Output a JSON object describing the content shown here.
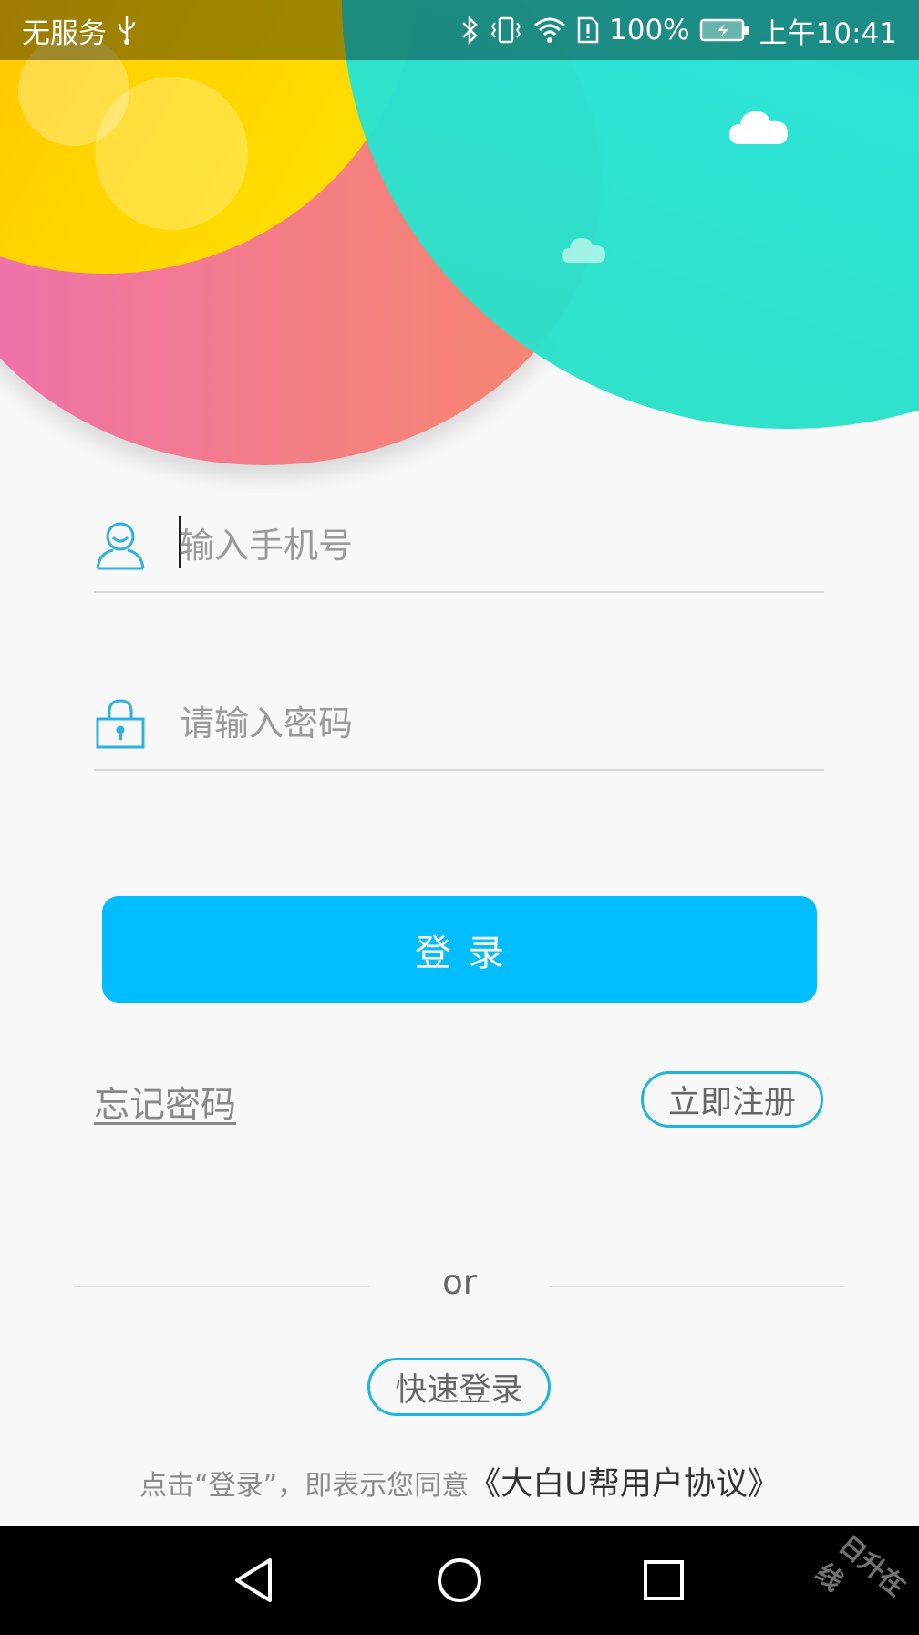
{
  "status_bar": {
    "carrier": "无服务",
    "battery_percent": "100%",
    "time": "上午10:41",
    "icons": [
      "usb-icon",
      "bluetooth-icon",
      "vibrate-icon",
      "wifi-icon",
      "sim-alert-icon",
      "battery-charging-icon"
    ]
  },
  "login_form": {
    "phone_placeholder": "输入手机号",
    "password_placeholder": "请输入密码",
    "login_label": "登录",
    "forgot_password": "忘记密码",
    "register_label": "立即注册"
  },
  "alternate": {
    "or_label": "or",
    "quick_login_label": "快速登录"
  },
  "agreement": {
    "prefix": "点击“登录”，即表示您同意",
    "link": "《大白U帮用户协议》"
  },
  "watermark": "日升在线",
  "colors": {
    "accent": "#02bdfd",
    "outline": "#1fb5d8",
    "icon": "#2fb1e0"
  }
}
